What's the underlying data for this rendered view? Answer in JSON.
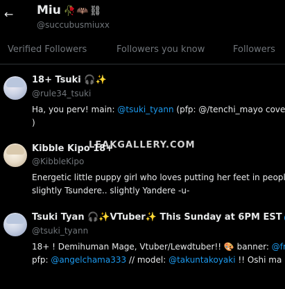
{
  "header": {
    "back_icon": "arrow-left-icon",
    "title": "Miu",
    "title_emoji": "🥀🦇⛓",
    "handle": "@succubusmiuxx"
  },
  "tabs": [
    "Verified Followers",
    "Followers you know",
    "Followers"
  ],
  "users": [
    {
      "name": "18+ Tsuki",
      "name_emoji": "🎧✨",
      "handle": "@rule34_tsuki",
      "bio_line1_pre": "Ha, you perv! main: ",
      "bio_line1_link": "@tsuki_tyann",
      "bio_line1_post": " (pfp: @/tenchi_mayo cover",
      "bio_line2": ")"
    },
    {
      "name": "Kibble Kipo 18+",
      "handle": "@KibbleKipo",
      "bio_line1": "Energetic little puppy girl who loves putting her feet in peopl",
      "bio_line2": "slightly Tsundere.. slightly Yandere -u-"
    },
    {
      "name": "Tsuki Tyan",
      "name_emoji_mid": "🎧✨",
      "name_rest": "VTuber",
      "name_emoji_end": "✨",
      "name_tail": " This Sunday at 6PM EST",
      "verified_icon": "verified-badge-icon",
      "handle": "@tsuki_tyann",
      "bio_line1_pre": "18+ ! Demihuman Mage, Vtuber/Lewdtuber!! 🎨 banner: ",
      "bio_line1_link": "@fr",
      "bio_line2_pre": "pfp: ",
      "bio_line2_link1": "@angelchama333",
      "bio_line2_mid": " // model: ",
      "bio_line2_link2": "@takuntakoyaki",
      "bio_line2_post": " !! Oshi ma"
    }
  ],
  "watermark": "LEAKGALLERY.COM"
}
